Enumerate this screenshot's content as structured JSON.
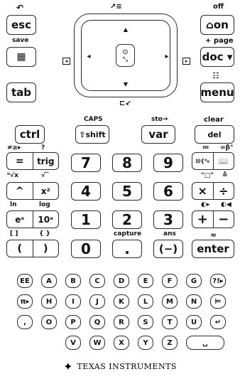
{
  "top": {
    "esc": {
      "label": "esc",
      "secondary": "↶"
    },
    "save": {
      "label": "save"
    },
    "scratchpad": {
      "glyph": "▦"
    },
    "tab": {
      "label": "tab"
    },
    "off": {
      "label": "off"
    },
    "on": {
      "label": "⌂on"
    },
    "page": {
      "label": "+ page"
    },
    "doc": {
      "label": "doc ▾"
    },
    "menu": {
      "label": "menu",
      "secondary": "☷"
    },
    "touchpad": {
      "up": "▲",
      "down": "▼",
      "left": "◂",
      "right": "▸",
      "center_glyph": "⊙",
      "top_icon": "↗≡",
      "bottom_icon": "⊏↙"
    }
  },
  "row1": {
    "ctrl": "ctrl",
    "caps": "CAPS",
    "shift": "⇧shift",
    "sto": "sto→",
    "var": "var",
    "clear": "clear",
    "del": "del"
  },
  "labels": {
    "r1": [
      "≠≥▸",
      "?"
    ],
    "r1b": [
      "≔",
      "∞β°"
    ],
    "r2": [
      "ⁿ√x",
      "√‾"
    ],
    "r2b": [
      "\"□\"",
      "≛"
    ],
    "r3": [
      "ln",
      "log"
    ],
    "r3b": [
      "◐▸",
      "◐◀"
    ],
    "r4": [
      "[ ]",
      "{ }"
    ],
    "capture": "capture",
    "ans": "ans",
    "approx": "≈"
  },
  "keys": {
    "equals": "=",
    "trig": "trig",
    "caret": "^",
    "x2": "x²",
    "ex": "eˣ",
    "tenx": "10ˣ",
    "lparen": "(",
    "rparen": ")",
    "seven": "7",
    "eight": "8",
    "nine": "9",
    "four": "4",
    "five": "5",
    "six": "6",
    "one": "1",
    "two": "2",
    "three": "3",
    "zero": "0",
    "dot": ".",
    "neg": "(−)",
    "enter": "enter",
    "templates": "⊞{⁰₀",
    "catalog": "📖",
    "mult": "×",
    "div": "÷",
    "plus": "+",
    "minus": "−"
  },
  "alpha": {
    "row1": [
      "EE",
      "A",
      "B",
      "C",
      "D",
      "E",
      "F",
      "G",
      "?!▸"
    ],
    "row2": [
      "π▸",
      "H",
      "I",
      "J",
      "K",
      "L",
      "M",
      "N",
      "⊨"
    ],
    "row3": [
      ",",
      "O",
      "P",
      "Q",
      "R",
      "S",
      "T",
      "U",
      "↵"
    ],
    "row4": [
      "V",
      "W",
      "X",
      "Y",
      "Z",
      "␣"
    ]
  },
  "brand": {
    "name": "TEXAS INSTRUMENTS",
    "logo": "✦"
  }
}
